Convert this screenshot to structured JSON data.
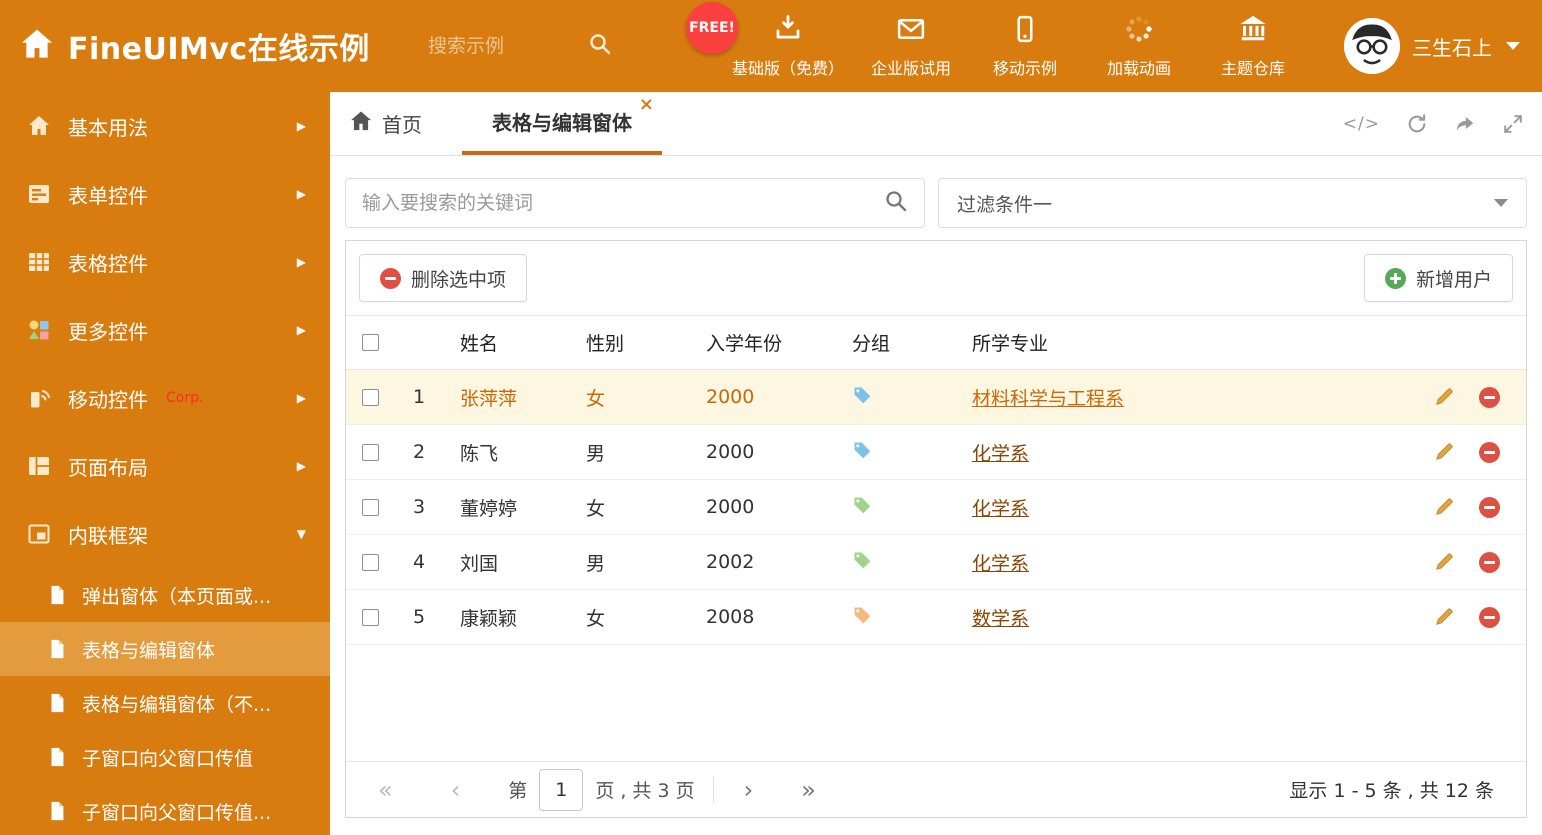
{
  "header": {
    "title": "FineUIMvc在线示例",
    "search_placeholder": "搜索示例",
    "free_badge": "FREE!",
    "nav": [
      {
        "label": "基础版（免费）"
      },
      {
        "label": "企业版试用"
      },
      {
        "label": "移动示例"
      },
      {
        "label": "加载动画"
      },
      {
        "label": "主题仓库"
      }
    ],
    "username": "三生石上"
  },
  "sidebar": {
    "items": [
      {
        "label": "基本用法"
      },
      {
        "label": "表单控件"
      },
      {
        "label": "表格控件"
      },
      {
        "label": "更多控件"
      },
      {
        "label": "移动控件",
        "badge": "Corp."
      },
      {
        "label": "页面布局"
      },
      {
        "label": "内联框架"
      }
    ],
    "subitems": [
      {
        "label": "弹出窗体（本页面或..."
      },
      {
        "label": "表格与编辑窗体"
      },
      {
        "label": "表格与编辑窗体（不..."
      },
      {
        "label": "子窗口向父窗口传值"
      },
      {
        "label": "子窗口向父窗口传值..."
      }
    ]
  },
  "tabs": {
    "home": "首页",
    "active": "表格与编辑窗体"
  },
  "filter": {
    "search_placeholder": "输入要搜索的关键词",
    "dropdown_value": "过滤条件一"
  },
  "toolbar": {
    "delete_label": "删除选中项",
    "add_label": "新增用户"
  },
  "table": {
    "headers": {
      "name": "姓名",
      "gender": "性别",
      "year": "入学年份",
      "group": "分组",
      "major": "所学专业"
    },
    "rows": [
      {
        "num": "1",
        "name": "张萍萍",
        "gender": "女",
        "year": "2000",
        "tag_color": "#7ec1e8",
        "major": "材料科学与工程系"
      },
      {
        "num": "2",
        "name": "陈飞",
        "gender": "男",
        "year": "2000",
        "tag_color": "#7ec1e8",
        "major": "化学系"
      },
      {
        "num": "3",
        "name": "董婷婷",
        "gender": "女",
        "year": "2000",
        "tag_color": "#9fd48a",
        "major": "化学系"
      },
      {
        "num": "4",
        "name": "刘国",
        "gender": "男",
        "year": "2002",
        "tag_color": "#9fd48a",
        "major": "化学系"
      },
      {
        "num": "5",
        "name": "康颖颖",
        "gender": "女",
        "year": "2008",
        "tag_color": "#f4b981",
        "major": "数学系"
      }
    ]
  },
  "pagination": {
    "prefix": "第",
    "current_page": "1",
    "suffix": "页 , 共 3 页",
    "summary": "显示 1 - 5 条 , 共 12 条"
  },
  "icons": {
    "code": "</>",
    "arrow_right": "▶",
    "caret_down": "▼",
    "close": "×",
    "first": "«",
    "prev": "‹",
    "next": "›",
    "last": "»"
  },
  "colors": {
    "accent": "#d87c10",
    "selected_row_bg": "#fdf6e1",
    "link": "#8a4500",
    "selected_text": "#c9690b",
    "danger": "#dd5044",
    "success": "#57a957"
  }
}
